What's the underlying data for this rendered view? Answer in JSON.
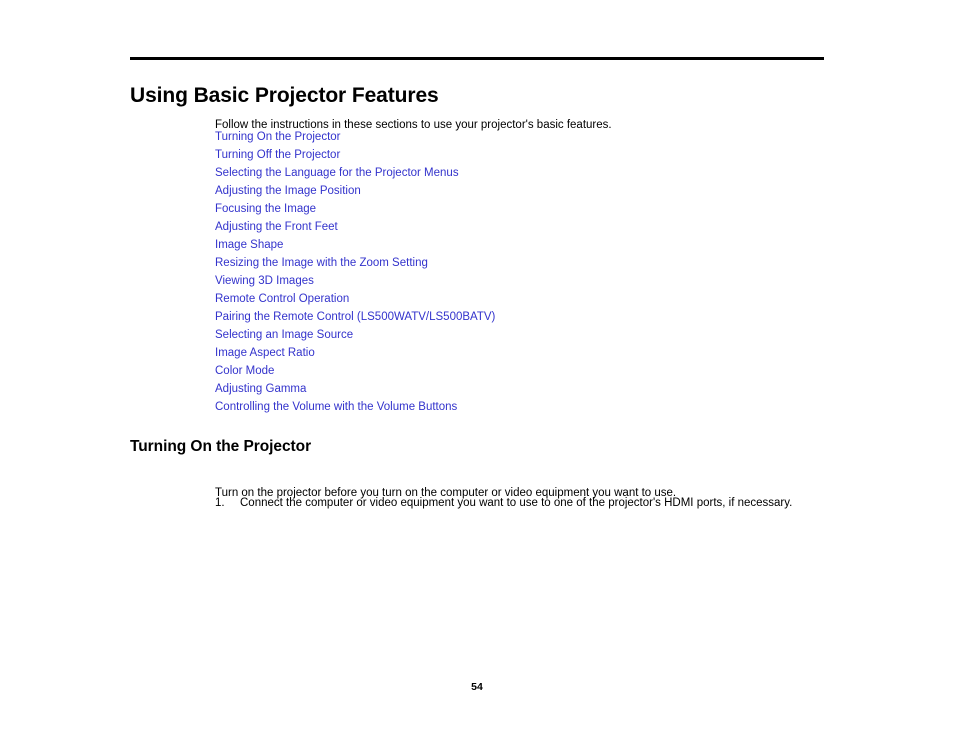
{
  "page": {
    "number": "54",
    "link_color": "#3333cc",
    "text_color": "#000000",
    "background_color": "#ffffff"
  },
  "chapter": {
    "title": "Using Basic Projector Features",
    "intro": "Follow the instructions in these sections to use your projector's basic features."
  },
  "toc": {
    "items": [
      {
        "label": "Turning On the Projector"
      },
      {
        "label": "Turning Off the Projector"
      },
      {
        "label": "Selecting the Language for the Projector Menus"
      },
      {
        "label": "Adjusting the Image Position"
      },
      {
        "label": "Focusing the Image"
      },
      {
        "label": "Adjusting the Front Feet"
      },
      {
        "label": "Image Shape"
      },
      {
        "label": "Resizing the Image with the Zoom Setting"
      },
      {
        "label": "Viewing 3D Images"
      },
      {
        "label": "Remote Control Operation"
      },
      {
        "label": "Pairing the Remote Control (LS500WATV/LS500BATV)"
      },
      {
        "label": "Selecting an Image Source"
      },
      {
        "label": "Image Aspect Ratio"
      },
      {
        "label": "Color Mode"
      },
      {
        "label": "Adjusting Gamma"
      },
      {
        "label": "Controlling the Volume with the Volume Buttons"
      }
    ]
  },
  "section": {
    "heading": "Turning On the Projector",
    "paragraph": "Turn on the projector before you turn on the computer or video equipment you want to use.",
    "steps": [
      {
        "number": "1.",
        "text": "Connect the computer or video equipment you want to use to one of the projector's HDMI ports, if necessary."
      }
    ]
  }
}
